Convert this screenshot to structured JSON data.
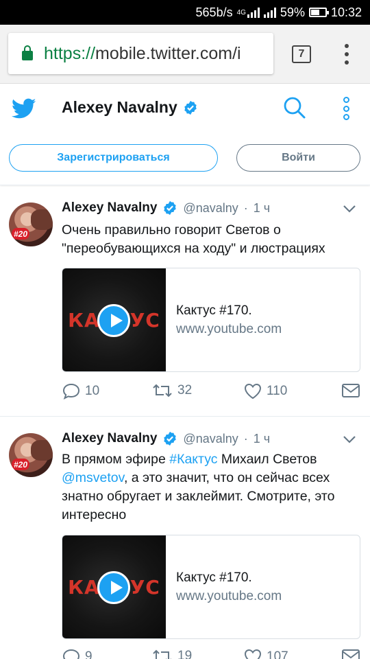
{
  "status_bar": {
    "speed": "565b/s",
    "network": "4G",
    "battery": "59%",
    "time": "10:32"
  },
  "browser": {
    "url_scheme": "https://",
    "url_rest": "mobile.twitter.com/i",
    "tab_count": "7"
  },
  "header": {
    "title": "Alexey Navalny",
    "signup_label": "Зарегистрироваться",
    "login_label": "Войти"
  },
  "tweets": [
    {
      "author": "Alexey Navalny",
      "handle": "@navalny",
      "separator": "·",
      "time": "1 ч",
      "avatar_badge": "#20",
      "text": "Очень правильно говорит Светов о \"переобувающихся на ходу\" и люстрациях",
      "card": {
        "thumb_text": "КАКТУС",
        "title": "Кактус #170.",
        "url": "www.youtube.com"
      },
      "replies": "10",
      "retweets": "32",
      "likes": "110"
    },
    {
      "author": "Alexey Navalny",
      "handle": "@navalny",
      "separator": "·",
      "time": "1 ч",
      "avatar_badge": "#20",
      "text_part1": "В прямом эфире ",
      "hashtag": "#Кактус",
      "text_part2": " Михаил Светов ",
      "mention": "@msvetov",
      "text_part3": ", а это значит, что он сейчас всех знатно обругает и заклеймит. Смотрите, это интересно",
      "card": {
        "thumb_text": "КАКТУС",
        "title": "Кактус #170.",
        "url": "www.youtube.com"
      },
      "replies": "9",
      "retweets": "19",
      "likes": "107"
    }
  ],
  "colors": {
    "twitter_blue": "#1DA1F2",
    "secure_green": "#0B8043",
    "secondary_text": "#657786"
  },
  "icons": [
    "twitter-bird-icon",
    "verified-badge-icon",
    "search-icon",
    "more-icon",
    "caret-down-icon",
    "reply-icon",
    "retweet-icon",
    "like-icon",
    "share-mail-icon",
    "play-icon",
    "lock-icon"
  ]
}
